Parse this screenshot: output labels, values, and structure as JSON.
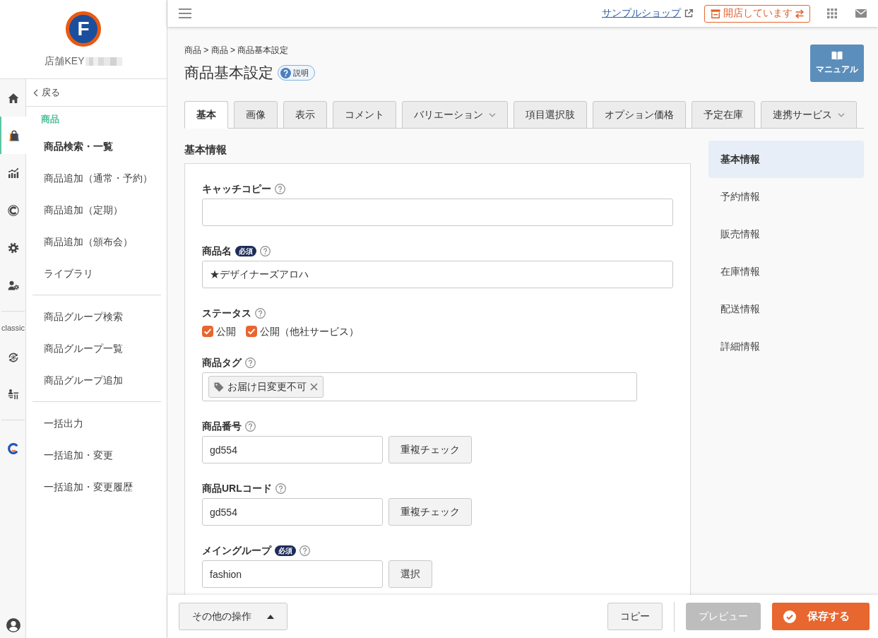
{
  "sidebar": {
    "logo_letter": "F",
    "shop_key_label": "店舗KEY",
    "rail_groups": [
      {
        "items": [
          {
            "selected": false
          },
          {
            "selected": true
          },
          {
            "selected": false
          },
          {
            "selected": false
          },
          {
            "selected": false
          },
          {
            "selected": false
          }
        ]
      },
      {
        "label": "classic",
        "items": [
          {
            "selected": false
          },
          {
            "selected": false
          }
        ]
      },
      {
        "items": [
          {
            "selected": false
          }
        ]
      }
    ],
    "back_link": "戻る",
    "menu_heading": "商品",
    "menu_groups": [
      {
        "items": [
          {
            "label": "商品検索・一覧",
            "selected": true
          },
          {
            "label": "商品追加（通常・予約）",
            "selected": false
          },
          {
            "label": "商品追加（定期）",
            "selected": false
          },
          {
            "label": "商品追加（頒布会）",
            "selected": false
          },
          {
            "label": "ライブラリ",
            "selected": false
          }
        ]
      },
      {
        "items": [
          {
            "label": "商品グループ検索",
            "selected": false
          },
          {
            "label": "商品グループ一覧",
            "selected": false
          },
          {
            "label": "商品グループ追加",
            "selected": false
          }
        ]
      },
      {
        "items": [
          {
            "label": "一括出力",
            "selected": false
          },
          {
            "label": "一括追加・変更",
            "selected": false
          },
          {
            "label": "一括追加・変更履歴",
            "selected": false
          }
        ]
      }
    ]
  },
  "topbar": {
    "shop_link": "サンプルショップ",
    "store_status": "開店しています"
  },
  "header": {
    "breadcrumb": "商品 > 商品 > 商品基本設定",
    "title": "商品基本設定",
    "help_button": "説明",
    "manual_button": "マニュアル"
  },
  "tabs": [
    {
      "label": "基本",
      "selected": true,
      "has_menu": false
    },
    {
      "label": "画像",
      "selected": false,
      "has_menu": false
    },
    {
      "label": "表示",
      "selected": false,
      "has_menu": false
    },
    {
      "label": "コメント",
      "selected": false,
      "has_menu": false
    },
    {
      "label": "バリエーション",
      "selected": false,
      "has_menu": true
    },
    {
      "label": "項目選択肢",
      "selected": false,
      "has_menu": false
    },
    {
      "label": "オプション価格",
      "selected": false,
      "has_menu": false
    },
    {
      "label": "予定在庫",
      "selected": false,
      "has_menu": false
    },
    {
      "label": "連携サービス",
      "selected": false,
      "has_menu": true
    }
  ],
  "section_title": "基本情報",
  "fields": [
    {
      "kind": "text",
      "label": "キャッチコピー"
    },
    {
      "kind": "text",
      "label": "商品名",
      "badge": "必須",
      "value": "★デザイナーズアロハ"
    },
    {
      "kind": "checkboxes",
      "label": "ステータス",
      "options": [
        {
          "label": "公開",
          "checked": true
        },
        {
          "label": "公開（他社サービス）",
          "checked": true
        }
      ]
    },
    {
      "kind": "tags",
      "label": "商品タグ",
      "tags": [
        "お届け日変更不可"
      ]
    },
    {
      "kind": "text_button",
      "label": "商品番号",
      "value": "gd554",
      "button": "重複チェック"
    },
    {
      "kind": "text_button",
      "label": "商品URLコード",
      "value": "gd554",
      "button": "重複チェック"
    },
    {
      "kind": "text_button",
      "label": "メイングループ",
      "badge": "必須",
      "value": "fashion",
      "button": "選択"
    }
  ],
  "section_nav": [
    {
      "label": "基本情報",
      "selected": true
    },
    {
      "label": "予約情報",
      "selected": false
    },
    {
      "label": "販売情報",
      "selected": false
    },
    {
      "label": "在庫情報",
      "selected": false
    },
    {
      "label": "配送情報",
      "selected": false
    },
    {
      "label": "詳細情報",
      "selected": false
    }
  ],
  "footer": {
    "more_actions": "その他の操作",
    "copy": "コピー",
    "preview": {
      "label": "プレビュー",
      "disabled": true
    },
    "save": "保存する"
  }
}
